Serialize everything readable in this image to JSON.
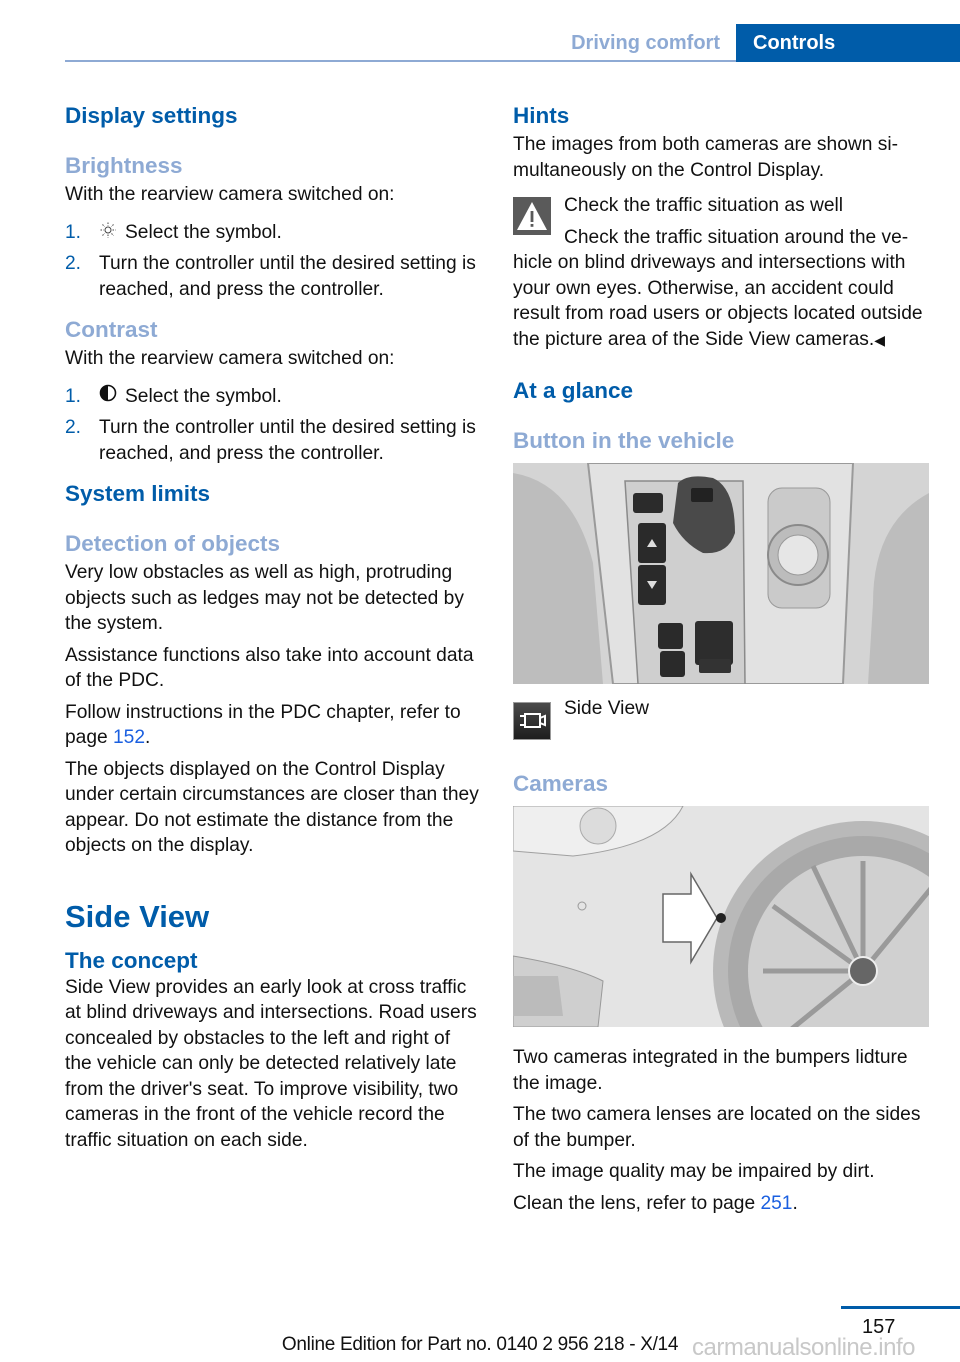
{
  "header": {
    "section": "Driving comfort",
    "chapter": "Controls",
    "accent_color": "#005ca9",
    "muted_color": "#8eaad4"
  },
  "left": {
    "display_settings": "Display settings",
    "brightness": {
      "title": "Brightness",
      "intro": "With the rearview camera switched on:",
      "steps": [
        {
          "num": "1.",
          "icon": "brightness-sun-icon",
          "text": "Select the symbol."
        },
        {
          "num": "2.",
          "text": "Turn the controller until the desired setting is reached, and press the controller."
        }
      ]
    },
    "contrast": {
      "title": "Contrast",
      "intro": "With the rearview camera switched on:",
      "steps": [
        {
          "num": "1.",
          "icon": "contrast-half-circle-icon",
          "text": "Select the symbol."
        },
        {
          "num": "2.",
          "text": "Turn the controller until the desired setting is reached, and press the controller."
        }
      ]
    },
    "system_limits": "System limits",
    "detection": {
      "title": "Detection of objects",
      "p1": "Very low obstacles as well as high, protruding objects such as ledges may not be detected by the system.",
      "p2": "Assistance functions also take into account data of the PDC.",
      "p3_pre": "Follow instructions in the PDC chapter, refer to page ",
      "p3_link": "152",
      "p3_post": ".",
      "p4": "The objects displayed on the Control Display under certain circumstances are closer than they appear. Do not estimate the distance from the objects on the display."
    },
    "side_view": "Side View",
    "concept": {
      "title": "The concept",
      "text": "Side View provides an early look at cross traffic at blind driveways and intersections. Road users concealed by obstacles to the left and right of the vehicle can only be detected rela­tively late from the driver's seat. To improve visibility, two cameras in the front of the vehi­cle record the traffic situation on each side."
    }
  },
  "right": {
    "hints": {
      "title": "Hints",
      "text": "The images from both cameras are shown si­multaneously on the Control Display."
    },
    "warning": {
      "icon": "warning-triangle-icon",
      "title": "Check the traffic situation as well",
      "body": "Check the traffic situation around the ve­hicle on blind driveways and intersections with your own eyes. Otherwise, an accident could result from road users or objects located out­side the picture area of the Side View cam­eras.",
      "end_mark": "◀"
    },
    "at_a_glance": "At a glance",
    "button_in_vehicle": "Button in the vehicle",
    "button_image_alt": "Center console with gear selector, Side View button and iDrive controller",
    "side_view_button": {
      "icon": "side-view-camera-icon",
      "label": "Side View"
    },
    "cameras": {
      "title": "Cameras",
      "image_alt": "Front bumper with arrow pointing to side camera lens near the wheel",
      "p1": "Two cameras integrated in the bumpers lidture the image.",
      "p2": "The two camera lenses are located on the sides of the bumper.",
      "p3": "The image quality may be impaired by dirt.",
      "p4_pre": "Clean the lens, refer to page ",
      "p4_link": "251",
      "p4_post": "."
    }
  },
  "footer": {
    "page_number": "157",
    "edition": "Online Edition for Part no. 0140 2 956 218 - X/14",
    "watermark": "carmanualsonline.info"
  }
}
